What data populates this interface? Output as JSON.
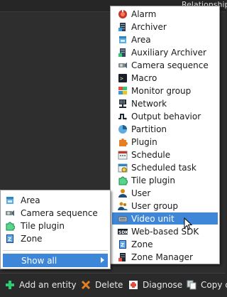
{
  "background": {
    "header_text": "Relationships"
  },
  "entity_menu": {
    "items": [
      {
        "label": "Alarm",
        "icon": "alarm-icon"
      },
      {
        "label": "Archiver",
        "icon": "archiver-icon"
      },
      {
        "label": "Area",
        "icon": "area-icon"
      },
      {
        "label": "Auxiliary Archiver",
        "icon": "auxiliary-archiver-icon"
      },
      {
        "label": "Camera sequence",
        "icon": "camera-sequence-icon"
      },
      {
        "label": "Macro",
        "icon": "macro-icon"
      },
      {
        "label": "Monitor group",
        "icon": "monitor-group-icon"
      },
      {
        "label": "Network",
        "icon": "network-icon"
      },
      {
        "label": "Output behavior",
        "icon": "output-behavior-icon"
      },
      {
        "label": "Partition",
        "icon": "partition-icon"
      },
      {
        "label": "Plugin",
        "icon": "plugin-icon"
      },
      {
        "label": "Schedule",
        "icon": "schedule-icon"
      },
      {
        "label": "Scheduled task",
        "icon": "scheduled-task-icon"
      },
      {
        "label": "Tile plugin",
        "icon": "tile-plugin-icon"
      },
      {
        "label": "User",
        "icon": "user-icon"
      },
      {
        "label": "User group",
        "icon": "user-group-icon"
      },
      {
        "label": "Video unit",
        "icon": "video-unit-icon"
      },
      {
        "label": "Web-based SDK",
        "icon": "sdk-icon"
      },
      {
        "label": "Zone",
        "icon": "zone-icon"
      },
      {
        "label": "Zone Manager",
        "icon": "zone-manager-icon"
      }
    ],
    "highlighted": "Video unit"
  },
  "recent_menu": {
    "items": [
      {
        "label": "Area",
        "icon": "area-icon"
      },
      {
        "label": "Camera sequence",
        "icon": "camera-sequence-icon"
      },
      {
        "label": "Tile plugin",
        "icon": "tile-plugin-icon"
      },
      {
        "label": "Zone",
        "icon": "zone-icon"
      }
    ],
    "show_all": "Show all"
  },
  "toolbar": {
    "add_entity": "Add an entity",
    "delete": "Delete",
    "diagnose": "Diagnose",
    "copy": "Copy c"
  },
  "colors": {
    "highlight": "#3e86d8",
    "menu_bg": "#ffffff",
    "toolbar_bg": "#2a2a2a"
  }
}
